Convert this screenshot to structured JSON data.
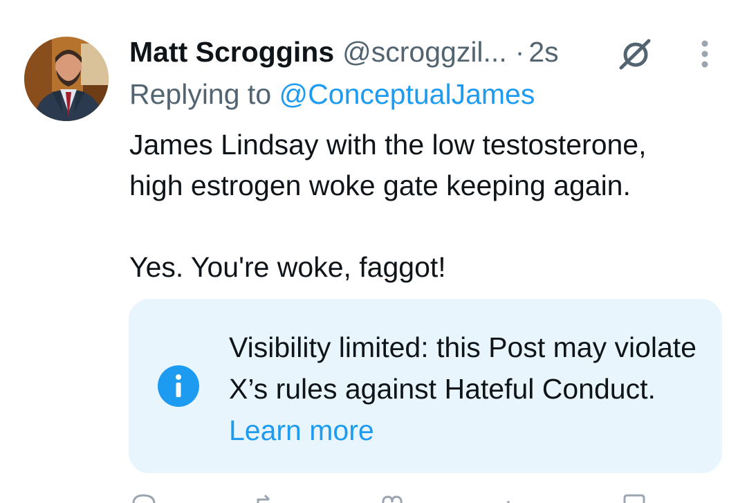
{
  "author": {
    "name": "Matt Scroggins",
    "handle": "@scroggzil...",
    "separator": "·",
    "time": "2s"
  },
  "reply": {
    "prefix": "Replying to",
    "mention": "@ConceptualJames"
  },
  "body": {
    "line1": "James Lindsay with the low testosterone,",
    "line2": "high estrogen woke gate keeping again.",
    "line3": "Yes. You're woke, faggot!"
  },
  "notice": {
    "text": "Visibility limited: this Post may violate X’s rules against Hateful Conduct.",
    "link": "Learn more"
  },
  "icons": {
    "grok": "grok-icon",
    "more": "more-vertical-icon",
    "info": "info-icon",
    "reply": "reply-icon",
    "repost": "repost-icon",
    "like": "like-icon",
    "views": "views-icon",
    "bookmark": "bookmark-icon",
    "share": "share-icon"
  },
  "colors": {
    "accent": "#1d9bf0",
    "secondary_text": "#536471",
    "notice_bg": "#e8f5fd"
  }
}
